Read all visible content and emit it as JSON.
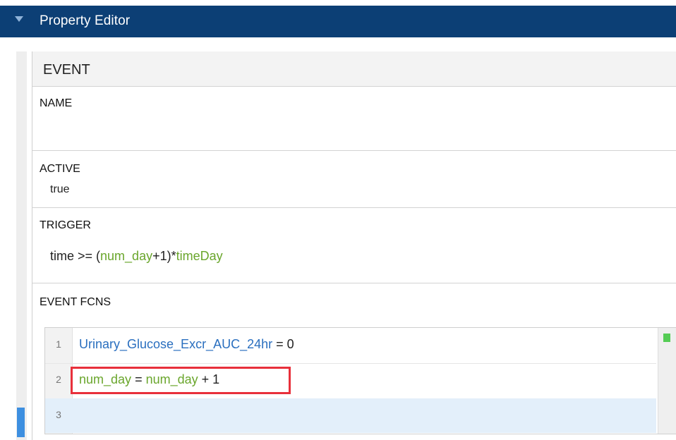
{
  "window": {
    "title": "Property Editor"
  },
  "event": {
    "header": "EVENT",
    "name": {
      "label": "NAME",
      "value": ""
    },
    "active": {
      "label": "ACTIVE",
      "value": "true"
    },
    "trigger": {
      "label": "TRIGGER",
      "tokens": [
        {
          "text": "time >= (",
          "style": "plain"
        },
        {
          "text": "num_day",
          "style": "green"
        },
        {
          "text": "+1)*",
          "style": "plain"
        },
        {
          "text": "timeDay",
          "style": "green"
        }
      ]
    },
    "event_fcns": {
      "label": "EVENT FCNS",
      "lines": [
        {
          "number": "1",
          "tokens": [
            {
              "text": "Urinary_Glucose_Excr_AUC_24hr",
              "style": "blue"
            },
            {
              "text": " = 0",
              "style": "plain"
            }
          ]
        },
        {
          "number": "2",
          "highlighted": true,
          "tokens": [
            {
              "text": "num_day",
              "style": "green"
            },
            {
              "text": " = ",
              "style": "plain"
            },
            {
              "text": "num_day",
              "style": "green"
            },
            {
              "text": " + 1",
              "style": "plain"
            }
          ]
        },
        {
          "number": "3",
          "active": true,
          "tokens": []
        }
      ]
    }
  },
  "colors": {
    "title_bar": "#0c3f75",
    "green_token": "#6aa62c",
    "blue_token": "#2a6fbf",
    "highlight_box": "#e8303b",
    "active_line": "#e3effa",
    "scroll_marker": "#55cc55"
  },
  "icons": {
    "collapse": "triangle-down-icon"
  }
}
